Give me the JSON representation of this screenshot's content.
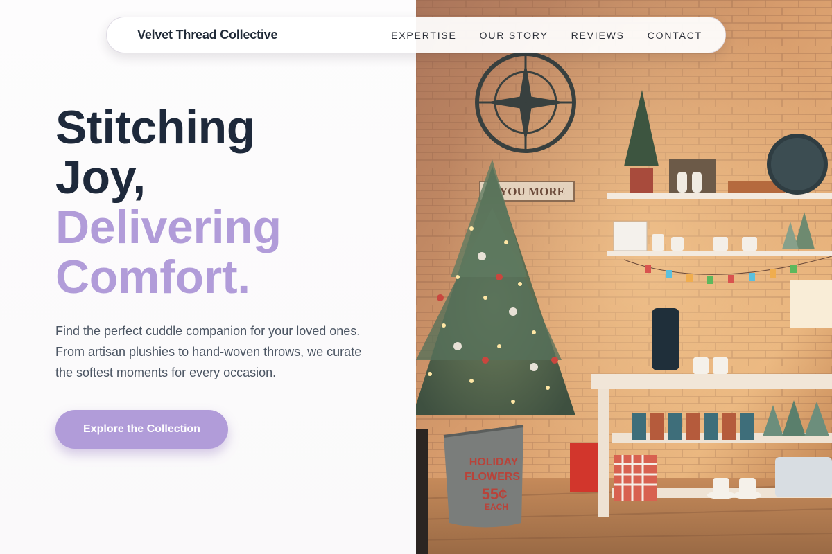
{
  "nav": {
    "brand": "Velvet Thread Collective",
    "links": [
      "EXPERTISE",
      "OUR STORY",
      "REVIEWS",
      "CONTACT"
    ]
  },
  "hero": {
    "headline": [
      "Stitching",
      "Joy,",
      "Delivering",
      "Comfort."
    ],
    "description": "Find the perfect cuddle companion for your loved ones. From artisan plushies to hand-woven throws, we curate the softest moments for every occasion.",
    "cta_label": "Explore the Collection"
  },
  "photo": {
    "sign_text": "E YOU MORE",
    "bucket_text": [
      "HOLIDAY",
      "FLOWERS",
      "55¢",
      "EACH"
    ]
  },
  "colors": {
    "accent": "#b19cd9",
    "heading_dark": "#1e293b",
    "body_text": "#4b5563"
  }
}
